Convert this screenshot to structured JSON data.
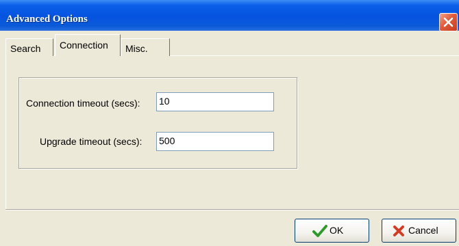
{
  "window": {
    "title": "Advanced Options"
  },
  "tabs": [
    {
      "label": "Search"
    },
    {
      "label": "Connection"
    },
    {
      "label": "Misc."
    }
  ],
  "connection": {
    "timeout_label": "Connection timeout (secs):",
    "timeout_value": "10",
    "upgrade_label": "Upgrade timeout (secs):",
    "upgrade_value": "500"
  },
  "buttons": {
    "ok": "OK",
    "cancel": "Cancel"
  },
  "icons": {
    "close": "close-icon",
    "ok": "checkmark-icon",
    "cancel": "x-icon"
  },
  "colors": {
    "titlebar": "#0553e0",
    "close": "#e25b3a",
    "ok_icon": "#2e9a2e",
    "cancel_icon": "#d63a22"
  }
}
